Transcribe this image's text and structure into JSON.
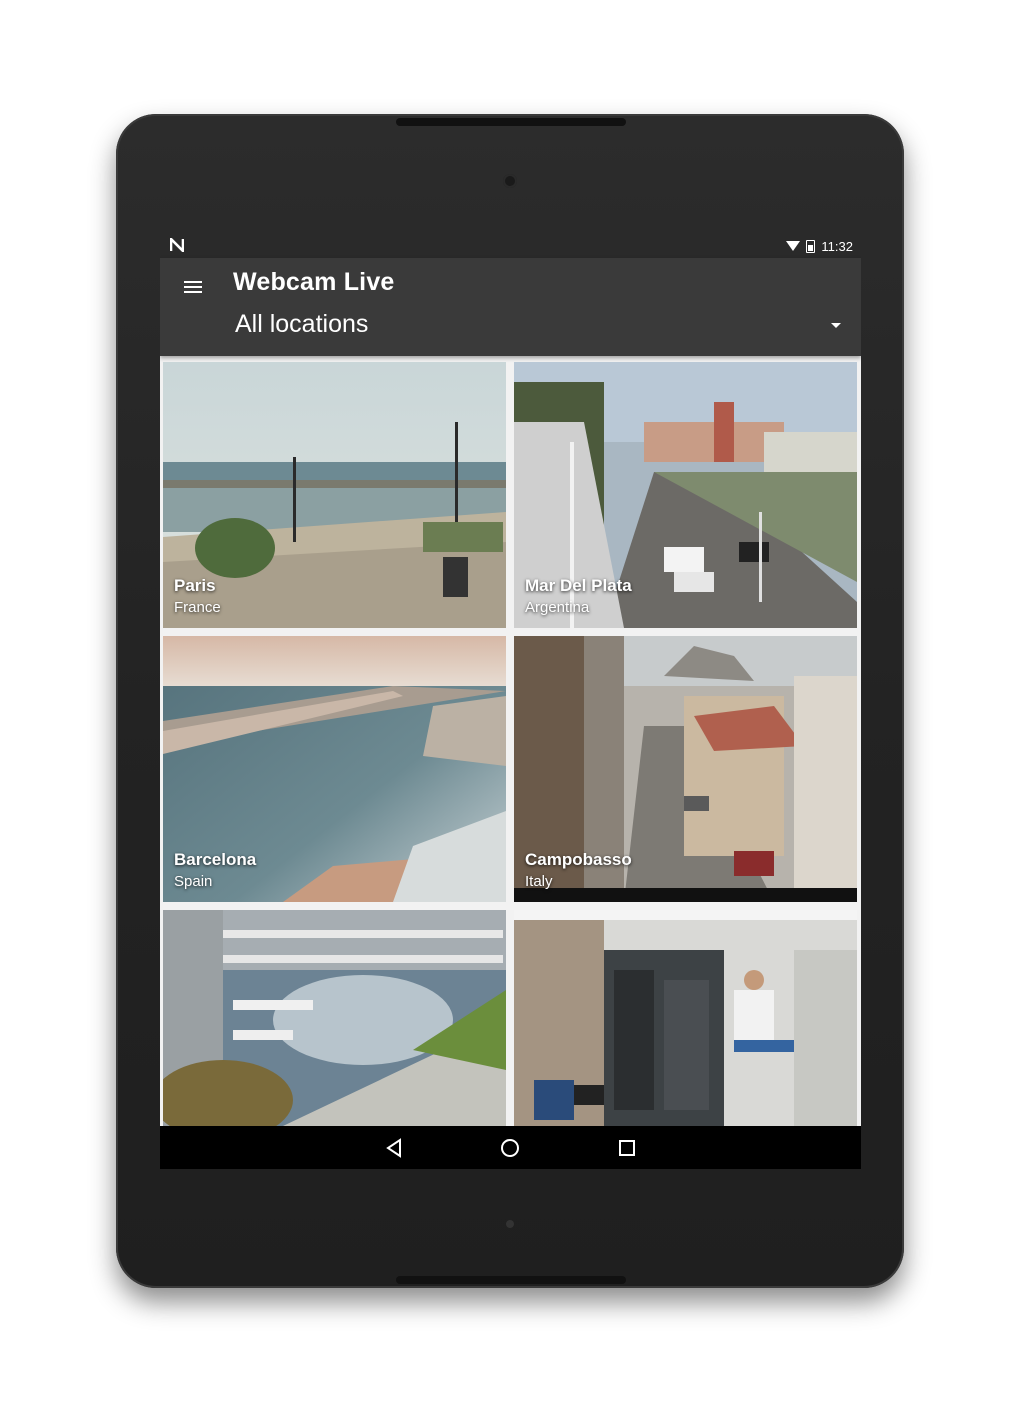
{
  "status_bar": {
    "notification_icon": "n-logo-icon",
    "time": "11:32",
    "icons": [
      "wifi-icon",
      "battery-icon"
    ]
  },
  "toolbar": {
    "title": "Webcam Live",
    "menu_icon": "hamburger-menu-icon",
    "location_filter": "All locations",
    "dropdown_icon": "dropdown-arrow-icon"
  },
  "webcams": [
    {
      "city": "Paris",
      "country": "France"
    },
    {
      "city": "Mar Del Plata",
      "country": "Argentina"
    },
    {
      "city": "Barcelona",
      "country": "Spain"
    },
    {
      "city": "Campobasso",
      "country": "Italy"
    },
    {
      "city": "",
      "country": ""
    },
    {
      "city": "",
      "country": ""
    }
  ],
  "nav_bar": {
    "icons": [
      "back-triangle-icon",
      "home-circle-icon",
      "recents-square-icon"
    ]
  }
}
